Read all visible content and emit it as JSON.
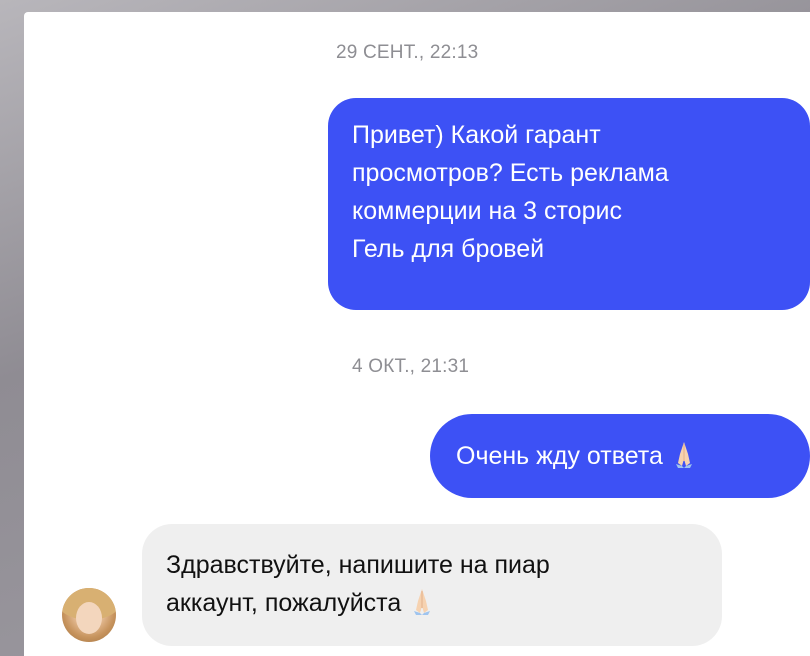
{
  "chat": {
    "timestamps": [
      "29 СЕНТ., 22:13",
      "4 ОКТ., 21:31"
    ],
    "outgoing_1": {
      "lines": [
        "Привет) Какой гарант",
        "просмотров? Есть реклама",
        "коммерции на 3 сторис",
        "Гель для бровей"
      ]
    },
    "outgoing_2": {
      "text": "Очень жду ответа",
      "emoji": "folded-hands-icon"
    },
    "incoming_1": {
      "lines": [
        "Здравствуйте, напишите на пиар",
        "аккаунт, пожалуйста"
      ],
      "emoji": "folded-hands-icon"
    }
  },
  "colors": {
    "outgoing_bubble": "#3d51f5",
    "incoming_bubble": "#efefef",
    "timestamp": "#8e8e93"
  }
}
